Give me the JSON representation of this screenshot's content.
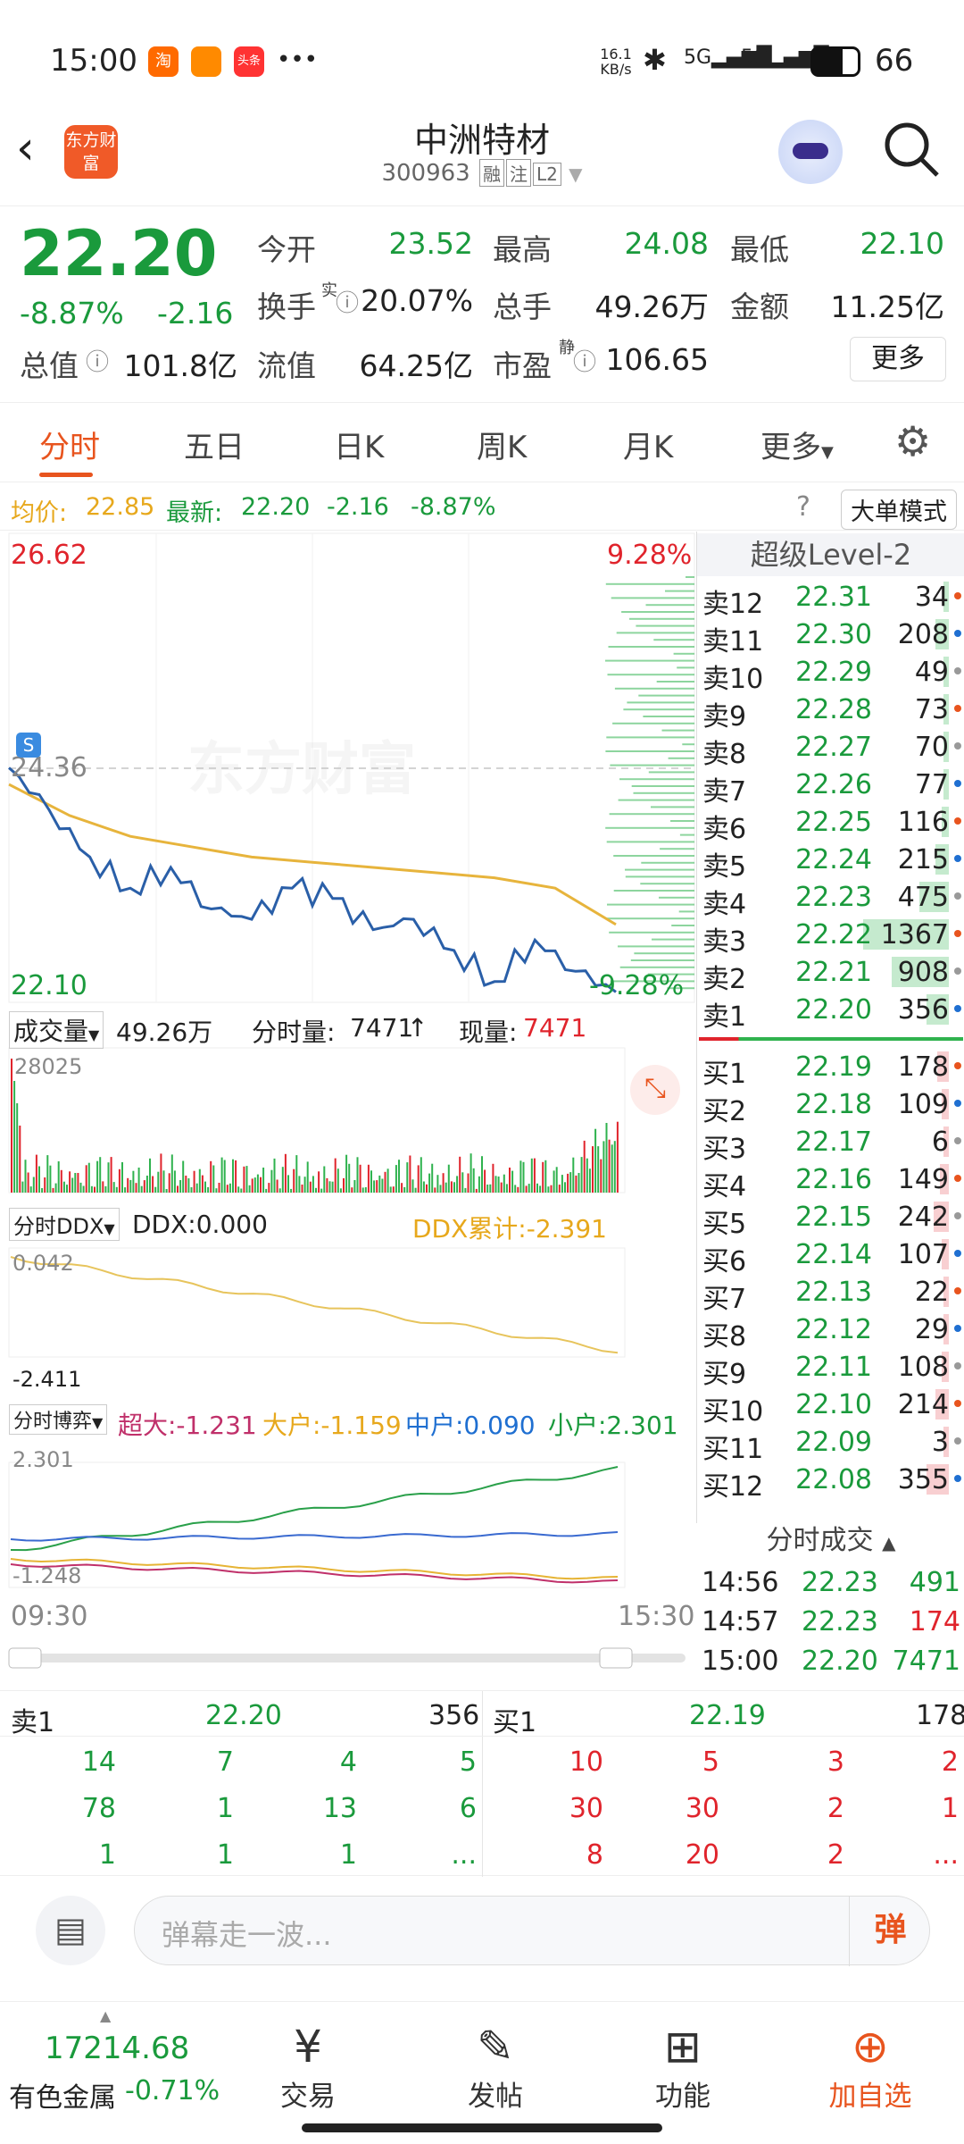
{
  "status_bar": {
    "time": "15:00",
    "net_speed": "16.1 KB/s",
    "battery": "66",
    "apps": [
      "淘",
      "",
      "头条"
    ],
    "dots": "•••"
  },
  "header": {
    "logo_text": "东方财富",
    "stock_name": "中洲特材",
    "stock_code": "300963",
    "tags": [
      "融",
      "注",
      "L2"
    ]
  },
  "quote": {
    "price": "22.20",
    "change_pct": "-8.87%",
    "change": "-2.16",
    "open_label": "今开",
    "open": "23.52",
    "high_label": "最高",
    "high": "24.08",
    "low_label": "最低",
    "low": "22.10",
    "turnover_label": "换手",
    "turnover_sup": "实",
    "turnover": "20.07%",
    "volume_label": "总手",
    "volume": "49.26万",
    "amount_label": "金额",
    "amount": "11.25亿",
    "mktcap_label": "总值",
    "mktcap": "101.8亿",
    "float_label": "流值",
    "float": "64.25亿",
    "pe_label": "市盈",
    "pe_sup": "静",
    "pe": "106.65",
    "more": "更多"
  },
  "tabs": [
    "分时",
    "五日",
    "日K",
    "周K",
    "月K",
    "更多"
  ],
  "avg_bar": {
    "avg_label": "均价:",
    "avg": "22.85",
    "last_label": "最新:",
    "last": "22.20",
    "chg": "-2.16",
    "pct": "-8.87%",
    "mode_btn": "大单模式"
  },
  "chart": {
    "y_max": "26.62",
    "y_max_pct": "9.28%",
    "y_min": "22.10",
    "y_min_pct": "-9.28%",
    "prev_close": "24.36",
    "watermark": "东方财富",
    "time_start": "09:30",
    "time_end": "15:30",
    "vol_label": "成交量",
    "vol_total": "49.26万",
    "vol_min_label": "分时量:",
    "vol_min": "7471",
    "vol_now_label": "现量:",
    "vol_now": "7471",
    "vol_max": "28025",
    "ddx_label": "分时DDX",
    "ddx": "DDX:0.000",
    "ddx_cum": "DDX累计:-2.391",
    "ddx_top": "0.042",
    "ddx_bot": "-2.411",
    "bo_label": "分时博弈",
    "bo_super": "超大:-1.231",
    "bo_big": "大户:-1.159",
    "bo_mid": "中户:0.090",
    "bo_small": "小户:2.301",
    "bo_top": "2.301",
    "bo_bot": "-1.248"
  },
  "chart_data": {
    "type": "line",
    "x": [
      "09:30",
      "15:00"
    ],
    "series": [
      {
        "values": [
          24.36,
          23.95,
          23.5,
          23.2,
          23.4,
          23.0,
          22.9,
          23.2,
          23.1,
          22.8,
          22.9,
          22.6,
          22.3,
          22.7,
          22.4,
          22.2
        ]
      },
      {
        "values": [
          24.2,
          23.9,
          23.7,
          23.6,
          23.5,
          23.45,
          23.4,
          23.35,
          23.3,
          23.2,
          22.85
        ]
      }
    ],
    "ylim": [
      22.1,
      26.62
    ]
  },
  "level2": {
    "title": "超级Level-2",
    "asks": [
      {
        "label": "卖12",
        "price": "22.31",
        "vol": "34"
      },
      {
        "label": "卖11",
        "price": "22.30",
        "vol": "208"
      },
      {
        "label": "卖10",
        "price": "22.29",
        "vol": "49"
      },
      {
        "label": "卖9",
        "price": "22.28",
        "vol": "73"
      },
      {
        "label": "卖8",
        "price": "22.27",
        "vol": "70"
      },
      {
        "label": "卖7",
        "price": "22.26",
        "vol": "77"
      },
      {
        "label": "卖6",
        "price": "22.25",
        "vol": "116"
      },
      {
        "label": "卖5",
        "price": "22.24",
        "vol": "215"
      },
      {
        "label": "卖4",
        "price": "22.23",
        "vol": "475"
      },
      {
        "label": "卖3",
        "price": "22.22",
        "vol": "1367"
      },
      {
        "label": "卖2",
        "price": "22.21",
        "vol": "908"
      },
      {
        "label": "卖1",
        "price": "22.20",
        "vol": "356"
      }
    ],
    "bids": [
      {
        "label": "买1",
        "price": "22.19",
        "vol": "178"
      },
      {
        "label": "买2",
        "price": "22.18",
        "vol": "109"
      },
      {
        "label": "买3",
        "price": "22.17",
        "vol": "6"
      },
      {
        "label": "买4",
        "price": "22.16",
        "vol": "149"
      },
      {
        "label": "买5",
        "price": "22.15",
        "vol": "242"
      },
      {
        "label": "买6",
        "price": "22.14",
        "vol": "107"
      },
      {
        "label": "买7",
        "price": "22.13",
        "vol": "22"
      },
      {
        "label": "买8",
        "price": "22.12",
        "vol": "29"
      },
      {
        "label": "买9",
        "price": "22.11",
        "vol": "108"
      },
      {
        "label": "买10",
        "price": "22.10",
        "vol": "214"
      },
      {
        "label": "买11",
        "price": "22.09",
        "vol": "3"
      },
      {
        "label": "买12",
        "price": "22.08",
        "vol": "355"
      }
    ],
    "trades_title": "分时成交",
    "trades": [
      {
        "time": "14:56",
        "price": "22.23",
        "vol": "491"
      },
      {
        "time": "14:57",
        "price": "22.23",
        "vol": "174"
      },
      {
        "time": "15:00",
        "price": "22.20",
        "vol": "7471"
      }
    ]
  },
  "summary": {
    "sell_label": "卖1",
    "sell_price": "22.20",
    "sell_vol": "356",
    "buy_label": "买1",
    "buy_price": "22.19",
    "buy_vol": "178",
    "sell_rows": [
      [
        "14",
        "7",
        "4",
        "5"
      ],
      [
        "78",
        "1",
        "13",
        "6"
      ],
      [
        "1",
        "1",
        "1",
        "..."
      ]
    ],
    "buy_rows": [
      [
        "10",
        "5",
        "3",
        "2"
      ],
      [
        "30",
        "30",
        "2",
        "1"
      ],
      [
        "8",
        "20",
        "2",
        "..."
      ]
    ]
  },
  "comment": {
    "placeholder": "弹幕走一波...",
    "send": "弹"
  },
  "bottom_nav": {
    "index_value": "17214.68",
    "index_name": "有色金属",
    "index_pct": "-0.71%",
    "items": [
      "交易",
      "发帖",
      "功能",
      "加自选"
    ]
  }
}
